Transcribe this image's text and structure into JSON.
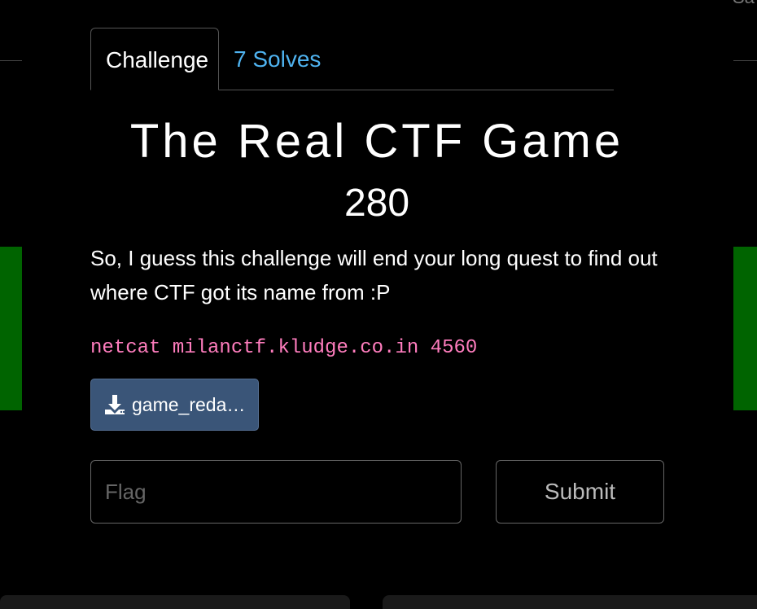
{
  "tabs": [
    {
      "label": "Challenge",
      "active": true
    },
    {
      "label": "7 Solves",
      "active": false
    }
  ],
  "challenge": {
    "title": "The Real CTF Game",
    "points": "280",
    "description": "So, I guess this challenge will end your long quest to find out where CTF got its name from :P",
    "command": "netcat milanctf.kludge.co.in 4560",
    "file_label": "game_reda…",
    "file_icon": "download-icon"
  },
  "submission": {
    "flag_placeholder": "Flag",
    "flag_value": "",
    "submit_label": "Submit"
  },
  "background": {
    "corner_text": "Sa"
  },
  "colors": {
    "background": "#000000",
    "solves_tab": "#4fb3f0",
    "command_text": "#ff7dbe",
    "download_button": "#3a5578",
    "side_block": "#006400"
  }
}
